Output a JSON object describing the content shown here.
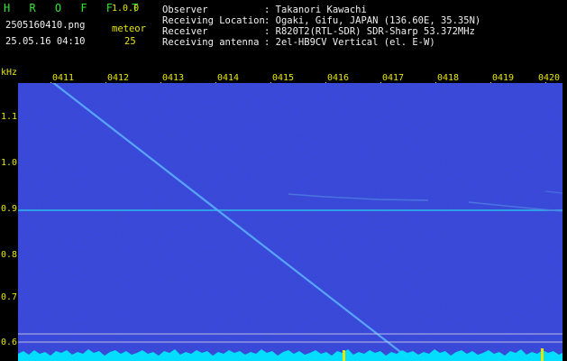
{
  "app": {
    "name": "H R O F F T",
    "version": "1.0.0"
  },
  "file": {
    "filename": "2505160410.png",
    "datetime": "25.05.16 04:10"
  },
  "counter": {
    "label": "meteor",
    "value": "25"
  },
  "info": [
    {
      "label": "Observer",
      "value": ": Takanori Kawachi"
    },
    {
      "label": "Receiving Location",
      "value": ": Ogaki, Gifu, JAPAN (136.60E, 35.35N)"
    },
    {
      "label": "Receiver",
      "value": ": R820T2(RTL-SDR) SDR-Sharp 53.372MHz"
    },
    {
      "label": "Receiving antenna",
      "value": ": 2el-HB9CV Vertical (el. E-W)"
    }
  ],
  "axes": {
    "y_unit": "kHz",
    "x_ticks": [
      "0411",
      "0412",
      "0413",
      "0414",
      "0415",
      "0416",
      "0417",
      "0418",
      "0419",
      "0420"
    ],
    "y_ticks": [
      "1.1",
      "1.0",
      "0.9",
      "0.8",
      "0.7",
      "0.6"
    ]
  },
  "colors": {
    "background": "#0a0a5a",
    "trace": "#5aa8ff",
    "carrier": "#2ad0f0",
    "label": "#e6e600",
    "floor": "#00e6ff"
  }
}
